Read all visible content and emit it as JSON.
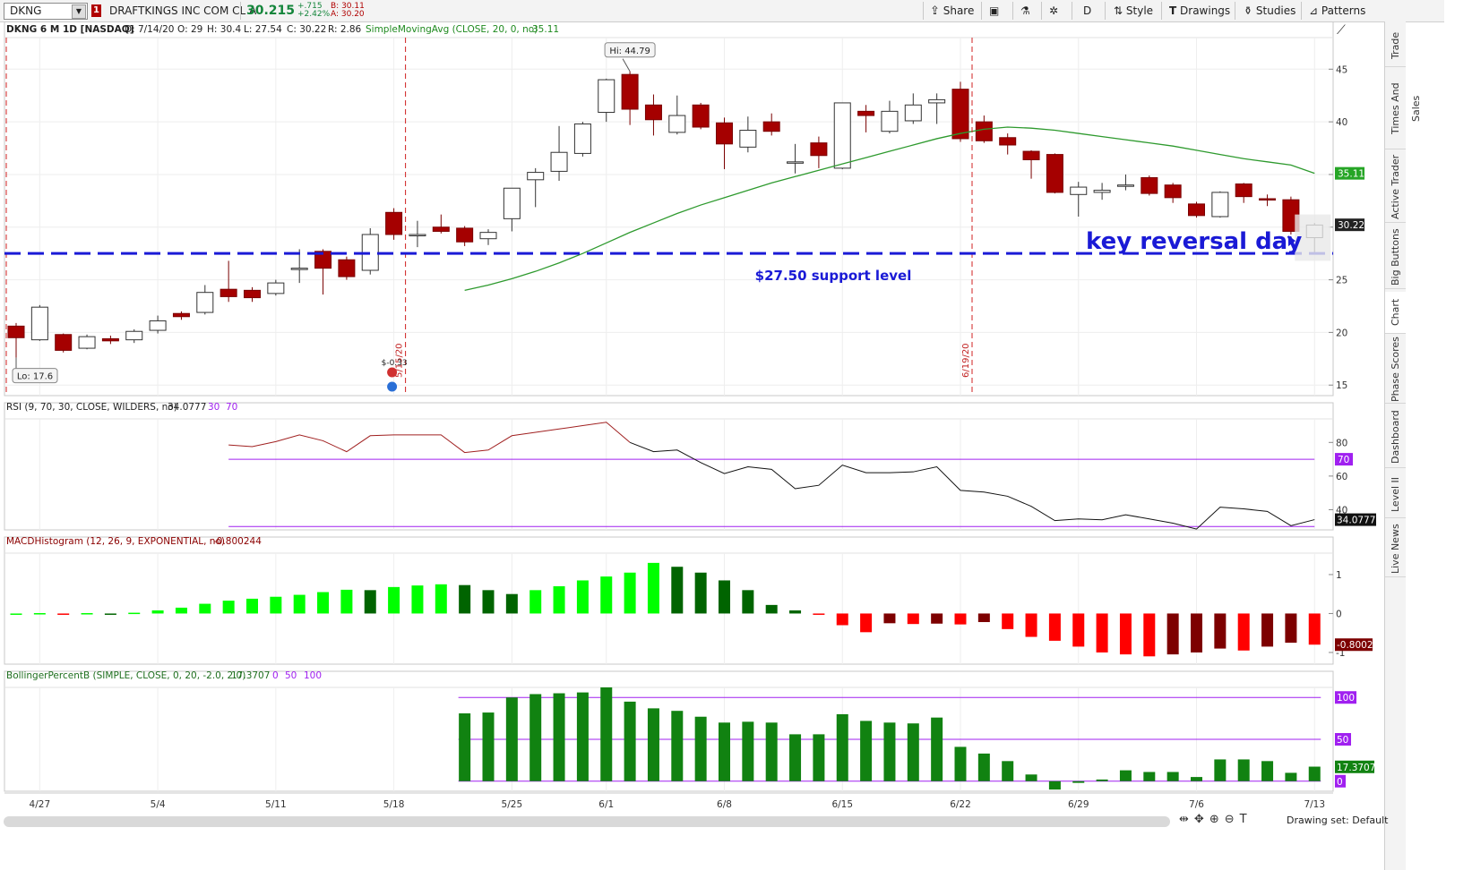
{
  "toolbar": {
    "symbol": "DKNG",
    "link_badge": "1",
    "company": "DRAFTKINGS INC COM CL A",
    "last": "30.215",
    "change": "+.715",
    "change_pct": "+2.42%",
    "bid": "B: 30.11",
    "ask": "A: 30.20",
    "share": "Share",
    "aggregation": "D",
    "style": "Style",
    "drawings": "Drawings",
    "studies": "Studies",
    "patterns": "Patterns"
  },
  "sidebar": {
    "tabs": [
      "Trade",
      "Times And Sales",
      "Active Trader",
      "Big Buttons",
      "Chart",
      "Phase Scores",
      "Dashboard",
      "Level II",
      "Live News"
    ],
    "active": "Chart"
  },
  "bottom": {
    "drawing_set": "Drawing set: Default"
  },
  "chart_data": [
    {
      "type": "candlestick",
      "title": "DKNG 6 M 1D [NASDAQ]",
      "header": {
        "date": "D: 7/14/20",
        "open": "O: 29",
        "high": "H: 30.4",
        "low": "L: 27.54",
        "close": "C: 30.22",
        "range": "R: 2.86"
      },
      "study_label": "SimpleMovingAvg (CLOSE, 20, 0, no)",
      "study_value": "35.11",
      "ylim": [
        14,
        48
      ],
      "yticks": [
        "15",
        "20",
        "25",
        "30",
        "35",
        "40",
        "45"
      ],
      "x_labels": [
        {
          "i": 1,
          "label": "4/27"
        },
        {
          "i": 6,
          "label": "5/4"
        },
        {
          "i": 11,
          "label": "5/11"
        },
        {
          "i": 16,
          "label": "5/18"
        },
        {
          "i": 21,
          "label": "5/25"
        },
        {
          "i": 25,
          "label": "6/1"
        },
        {
          "i": 30,
          "label": "6/8"
        },
        {
          "i": 35,
          "label": "6/15"
        },
        {
          "i": 40,
          "label": "6/22"
        },
        {
          "i": 45,
          "label": "6/29"
        },
        {
          "i": 50,
          "label": "7/6"
        },
        {
          "i": 55,
          "label": "7/13"
        }
      ],
      "candles": [
        {
          "o": 20.6,
          "h": 20.9,
          "l": 17.6,
          "c": 19.5
        },
        {
          "o": 19.3,
          "h": 22.6,
          "l": 19.2,
          "c": 22.4
        },
        {
          "o": 19.8,
          "h": 19.9,
          "l": 18.1,
          "c": 18.3
        },
        {
          "o": 18.5,
          "h": 19.8,
          "l": 18.4,
          "c": 19.6
        },
        {
          "o": 19.4,
          "h": 19.7,
          "l": 18.9,
          "c": 19.2
        },
        {
          "o": 19.3,
          "h": 20.3,
          "l": 19.0,
          "c": 20.1
        },
        {
          "o": 20.2,
          "h": 21.6,
          "l": 19.9,
          "c": 21.1
        },
        {
          "o": 21.8,
          "h": 22.0,
          "l": 21.2,
          "c": 21.5
        },
        {
          "o": 21.9,
          "h": 24.5,
          "l": 21.7,
          "c": 23.8
        },
        {
          "o": 24.1,
          "h": 26.8,
          "l": 22.9,
          "c": 23.4
        },
        {
          "o": 24.0,
          "h": 24.3,
          "l": 22.9,
          "c": 23.3
        },
        {
          "o": 23.7,
          "h": 25.0,
          "l": 23.5,
          "c": 24.7
        },
        {
          "o": 26.0,
          "h": 27.9,
          "l": 24.7,
          "c": 26.1
        },
        {
          "o": 27.7,
          "h": 27.9,
          "l": 23.6,
          "c": 26.1
        },
        {
          "o": 26.9,
          "h": 27.2,
          "l": 25.0,
          "c": 25.3
        },
        {
          "o": 25.9,
          "h": 29.9,
          "l": 25.5,
          "c": 29.3
        },
        {
          "o": 31.4,
          "h": 31.8,
          "l": 28.8,
          "c": 29.3
        },
        {
          "o": 29.2,
          "h": 30.6,
          "l": 28.1,
          "c": 29.3
        },
        {
          "o": 30.0,
          "h": 31.2,
          "l": 29.4,
          "c": 29.6
        },
        {
          "o": 29.9,
          "h": 30.1,
          "l": 28.2,
          "c": 28.6
        },
        {
          "o": 28.9,
          "h": 29.8,
          "l": 28.3,
          "c": 29.5
        },
        {
          "o": 30.8,
          "h": 33.7,
          "l": 29.6,
          "c": 33.7
        },
        {
          "o": 34.5,
          "h": 35.6,
          "l": 31.9,
          "c": 35.2
        },
        {
          "o": 35.3,
          "h": 39.6,
          "l": 34.4,
          "c": 37.1
        },
        {
          "o": 37.0,
          "h": 40.0,
          "l": 36.7,
          "c": 39.8
        },
        {
          "o": 40.9,
          "h": 44.1,
          "l": 40.0,
          "c": 44.0
        },
        {
          "o": 44.5,
          "h": 44.8,
          "l": 39.7,
          "c": 41.2
        },
        {
          "o": 41.6,
          "h": 42.6,
          "l": 38.7,
          "c": 40.2
        },
        {
          "o": 39.0,
          "h": 42.5,
          "l": 38.8,
          "c": 40.6
        },
        {
          "o": 41.6,
          "h": 41.8,
          "l": 39.3,
          "c": 39.5
        },
        {
          "o": 39.9,
          "h": 40.4,
          "l": 35.5,
          "c": 37.9
        },
        {
          "o": 37.6,
          "h": 40.5,
          "l": 37.1,
          "c": 39.2
        },
        {
          "o": 40.0,
          "h": 40.8,
          "l": 38.7,
          "c": 39.1
        },
        {
          "o": 36.2,
          "h": 37.9,
          "l": 35.1,
          "c": 36.2
        },
        {
          "o": 38.0,
          "h": 38.6,
          "l": 35.6,
          "c": 36.8
        },
        {
          "o": 35.6,
          "h": 41.8,
          "l": 35.5,
          "c": 41.8
        },
        {
          "o": 41.0,
          "h": 41.6,
          "l": 39.0,
          "c": 40.6
        },
        {
          "o": 39.1,
          "h": 42.0,
          "l": 38.9,
          "c": 41.0
        },
        {
          "o": 40.1,
          "h": 42.7,
          "l": 39.8,
          "c": 41.6
        },
        {
          "o": 41.8,
          "h": 42.7,
          "l": 39.8,
          "c": 42.1
        },
        {
          "o": 43.1,
          "h": 43.8,
          "l": 38.1,
          "c": 38.4
        },
        {
          "o": 40.0,
          "h": 40.6,
          "l": 38.0,
          "c": 38.2
        },
        {
          "o": 38.5,
          "h": 38.9,
          "l": 36.9,
          "c": 37.8
        },
        {
          "o": 37.2,
          "h": 37.3,
          "l": 34.6,
          "c": 36.4
        },
        {
          "o": 36.9,
          "h": 37.0,
          "l": 33.2,
          "c": 33.3
        },
        {
          "o": 33.1,
          "h": 34.3,
          "l": 31.0,
          "c": 33.8
        },
        {
          "o": 33.3,
          "h": 34.2,
          "l": 32.6,
          "c": 33.5
        },
        {
          "o": 34.0,
          "h": 35.0,
          "l": 33.5,
          "c": 34.0
        },
        {
          "o": 34.7,
          "h": 34.9,
          "l": 33.0,
          "c": 33.2
        },
        {
          "o": 34.0,
          "h": 34.2,
          "l": 32.3,
          "c": 32.8
        },
        {
          "o": 32.2,
          "h": 32.4,
          "l": 30.9,
          "c": 31.1
        },
        {
          "o": 31.0,
          "h": 33.4,
          "l": 30.9,
          "c": 33.3
        },
        {
          "o": 34.1,
          "h": 34.2,
          "l": 32.3,
          "c": 32.9
        },
        {
          "o": 32.7,
          "h": 33.1,
          "l": 32.0,
          "c": 32.6
        },
        {
          "o": 32.6,
          "h": 32.9,
          "l": 29.3,
          "c": 29.6
        },
        {
          "o": 29.0,
          "h": 30.4,
          "l": 27.5,
          "c": 30.2
        }
      ],
      "sma20": [
        null,
        null,
        null,
        null,
        null,
        null,
        null,
        null,
        null,
        null,
        null,
        null,
        null,
        null,
        null,
        null,
        null,
        null,
        null,
        24.0,
        24.5,
        25.1,
        25.8,
        26.6,
        27.5,
        28.5,
        29.5,
        30.4,
        31.3,
        32.1,
        32.8,
        33.5,
        34.2,
        34.8,
        35.4,
        36.0,
        36.6,
        37.2,
        37.8,
        38.4,
        38.9,
        39.3,
        39.5,
        39.4,
        39.2,
        38.9,
        38.6,
        38.3,
        38.0,
        37.7,
        37.3,
        36.9,
        36.5,
        36.2,
        35.9,
        35.11
      ],
      "support": {
        "value": 27.5,
        "label": "$27.50 support level"
      },
      "annotation": "key reversal day",
      "hi_label": "Hi: 44.79",
      "lo_label": "Lo: 17.6",
      "event_lines": [
        {
          "i": 16,
          "label": "5/15/20"
        },
        {
          "i": 40,
          "label": "6/19/20"
        }
      ],
      "earnings_label": "$-0.33",
      "price_tags": {
        "sma": "35.11",
        "last": "30.22"
      }
    },
    {
      "type": "line",
      "title": "RSI (9, 70, 30, CLOSE, WILDERS, no)",
      "value": "34.0777",
      "levels": [
        "30",
        "70"
      ],
      "ylim": [
        28,
        94
      ],
      "yticks": [
        "40",
        "60",
        "80"
      ],
      "overbought": 70,
      "oversold": 30,
      "values": [
        null,
        null,
        null,
        null,
        null,
        null,
        null,
        null,
        null,
        78.5,
        77.5,
        80.5,
        84.5,
        81.0,
        74.5,
        84.0,
        84.5,
        84.5,
        84.5,
        74.0,
        75.5,
        84.0,
        86.0,
        88.0,
        90.0,
        92.0,
        80.0,
        74.5,
        75.5,
        68.0,
        61.5,
        65.5,
        64.0,
        52.5,
        54.5,
        66.5,
        62.0,
        62.0,
        62.5,
        65.5,
        51.5,
        50.5,
        48.0,
        42.0,
        33.5,
        34.5,
        34.0,
        37.0,
        34.5,
        32.0,
        28.5,
        41.5,
        40.5,
        39.0,
        30.5,
        34.08
      ],
      "overbought_from": 26
    },
    {
      "type": "bar",
      "title": "MACDHistogram (12, 26, 9, EXPONENTIAL, no)",
      "value": "-0.800244",
      "ylim": [
        -1.3,
        1.55
      ],
      "yticks": [
        "1",
        "0",
        "-1"
      ],
      "values": [
        0,
        0.01,
        -0.02,
        0.01,
        0,
        0.02,
        0.08,
        0.15,
        0.25,
        0.33,
        0.38,
        0.43,
        0.48,
        0.55,
        0.61,
        0.6,
        0.68,
        0.72,
        0.75,
        0.73,
        0.6,
        0.5,
        0.6,
        0.7,
        0.85,
        0.95,
        1.05,
        1.3,
        1.2,
        1.05,
        0.85,
        0.6,
        0.22,
        0.08,
        -0.03,
        -0.3,
        -0.48,
        -0.25,
        -0.27,
        -0.26,
        -0.28,
        -0.22,
        -0.4,
        -0.6,
        -0.7,
        -0.85,
        -1.0,
        -1.05,
        -1.1,
        -1.05,
        -1.0,
        -0.9,
        -0.95,
        -0.85,
        -0.75,
        -0.8
      ],
      "colors": {
        "pos_up": "#00ff00",
        "pos_down": "#006400",
        "neg_down": "#ff0000",
        "neg_up": "#7d0000"
      },
      "price_tag": "-0.8002"
    },
    {
      "type": "bar",
      "title": "BollingerPercentB (SIMPLE, CLOSE, 0, 20, -2.0, 2.0)",
      "value": "17.3707",
      "levels": [
        "0",
        "50",
        "100"
      ],
      "ylim": [
        -12,
        112
      ],
      "yticks": [],
      "values": [
        null,
        null,
        null,
        null,
        null,
        null,
        null,
        null,
        null,
        null,
        null,
        null,
        null,
        null,
        null,
        null,
        null,
        null,
        null,
        81,
        82,
        100,
        104,
        105,
        106,
        112,
        95,
        87,
        84,
        77,
        70,
        71,
        70,
        56,
        56,
        80,
        72,
        70,
        69,
        76,
        41,
        33,
        24,
        8,
        -10,
        -2,
        2,
        13,
        11,
        11,
        5,
        26,
        26,
        24,
        10,
        17.37
      ],
      "price_tags": [
        "100",
        "50",
        "0",
        "17.3707"
      ]
    }
  ]
}
